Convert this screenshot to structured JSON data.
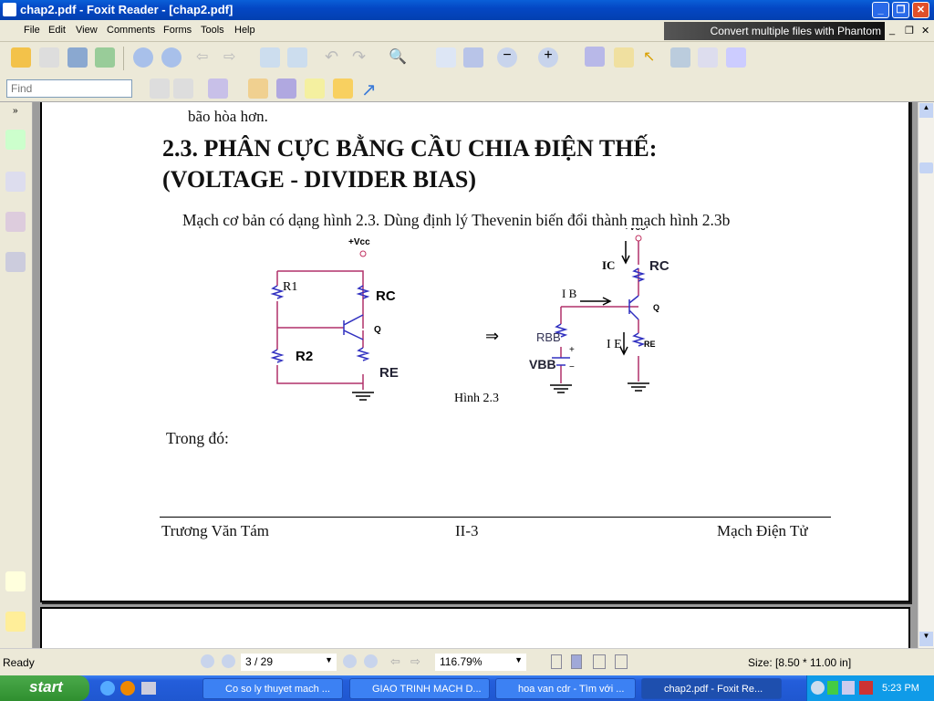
{
  "window": {
    "title": "chap2.pdf - Foxit Reader - [chap2.pdf]"
  },
  "menu": [
    "File",
    "Edit",
    "View",
    "Comments",
    "Forms",
    "Tools",
    "Help"
  ],
  "ad": "Convert multiple files with Phantom",
  "find": {
    "placeholder": "Find"
  },
  "doc": {
    "prev_line": "bão hòa hơn.",
    "heading1": "2.3. PHÂN CỰC BẰNG CẦU CHIA ĐIỆN THẾ:",
    "heading2": "(VOLTAGE - DIVIDER BIAS)",
    "paragraph": "Mạch cơ bản có dạng hình 2.3. Dùng định lý Thevenin biến đổi thành mạch hình 2.3b",
    "figure": {
      "vcc": "+Vcc",
      "r1": "R1",
      "r2": "R2",
      "rc": "RC",
      "re": "RE",
      "q": "Q",
      "arrow": "⇒",
      "ib": "I B",
      "ic": "IC",
      "ie": "I E",
      "rbb": "RBB",
      "vbb": "VBB",
      "plus": "+",
      "minus": "−",
      "caption": "Hình 2.3"
    },
    "trong_do": "Trong đó:",
    "footer": {
      "left": "Trương Văn Tám",
      "center": "II-3",
      "right": "Mạch Điện Tử"
    }
  },
  "status": {
    "ready": "Ready",
    "page": "3 / 29",
    "zoom": "116.79%",
    "size": "Size: [8.50 * 11.00 in]"
  },
  "taskbar": {
    "start": "start",
    "tasks": [
      "Co so ly thuyet mach ...",
      "GIAO TRINH MACH D...",
      "hoa van cdr - Tìm với ...",
      "chap2.pdf - Foxit Re..."
    ],
    "time": "5:23 PM"
  }
}
